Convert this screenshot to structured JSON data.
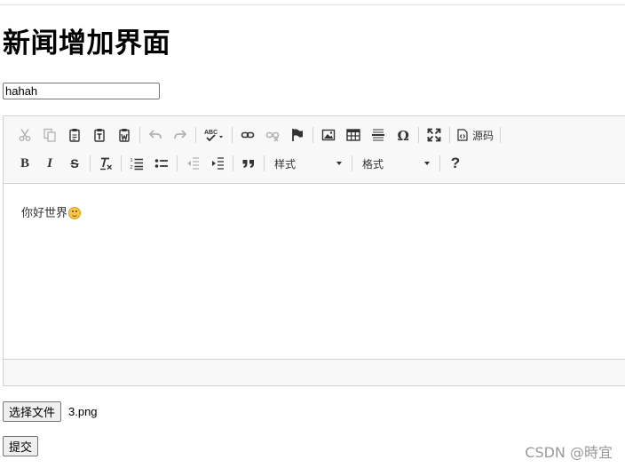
{
  "page": {
    "title": "新闻增加界面"
  },
  "form": {
    "title_value": "hahah",
    "file_button_label": "选择文件",
    "file_name": "3.png",
    "submit_label": "提交"
  },
  "editor": {
    "toolbar": {
      "source_label": "源码",
      "styles_label": "样式",
      "format_label": "格式",
      "bold": "B",
      "italic": "I",
      "strike": "S",
      "help": "?"
    },
    "content_text": "你好世界"
  },
  "watermark": "CSDN @時宜",
  "colors": {
    "toolbar_bg": "#f8f8f8",
    "border": "#d1d1d1",
    "icon": "#333333"
  }
}
